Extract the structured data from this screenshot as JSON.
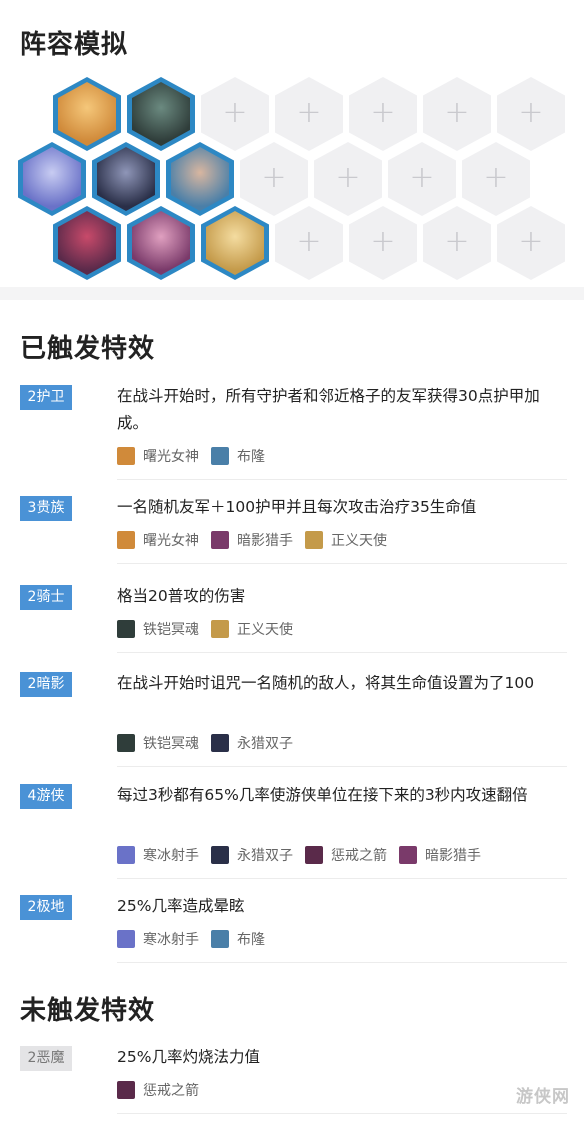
{
  "simulation": {
    "title": "阵容模拟",
    "slot_placeholder": "+",
    "champions": [
      {
        "name": "曙光女神",
        "icon": "leona-portrait-icon",
        "color": "#d08a3a",
        "accent": "#f5c77a"
      },
      {
        "name": "铁铠冥魂",
        "icon": "mordekaiser-portrait-icon",
        "color": "#2f3d3a",
        "accent": "#6b8a80"
      },
      {
        "name": "寒冰射手",
        "icon": "ashe-portrait-icon",
        "color": "#6a72c8",
        "accent": "#c8ccf2"
      },
      {
        "name": "永猎双子",
        "icon": "kindred-portrait-icon",
        "color": "#2a2f48",
        "accent": "#8f96b8"
      },
      {
        "name": "布隆",
        "icon": "braum-portrait-icon",
        "color": "#4a7fa8",
        "accent": "#d8b6a0"
      },
      {
        "name": "惩戒之箭",
        "icon": "varus-portrait-icon",
        "color": "#5a2a4a",
        "accent": "#c84a6a"
      },
      {
        "name": "暗影猎手",
        "icon": "vayne-portrait-icon",
        "color": "#7a3a6a",
        "accent": "#e0a0c0"
      },
      {
        "name": "正义天使",
        "icon": "kayle-portrait-icon",
        "color": "#c49a4a",
        "accent": "#f4dca0"
      }
    ]
  },
  "effects": {
    "active_title": "已触发特效",
    "inactive_title": "未触发特效",
    "active": [
      {
        "badge": "2护卫",
        "desc": "在战斗开始时，所有守护者和邻近格子的友军获得30点护甲加成。",
        "champions": [
          {
            "name": "曙光女神",
            "icon": "leona-icon",
            "color": "#d08a3a"
          },
          {
            "name": "布隆",
            "icon": "braum-icon",
            "color": "#4a7fa8"
          }
        ]
      },
      {
        "badge": "3贵族",
        "desc": "一名随机友军＋100护甲并且每次攻击治疗35生命值",
        "champions": [
          {
            "name": "曙光女神",
            "icon": "leona-icon",
            "color": "#d08a3a"
          },
          {
            "name": "暗影猎手",
            "icon": "vayne-icon",
            "color": "#7a3a6a"
          },
          {
            "name": "正义天使",
            "icon": "kayle-icon",
            "color": "#c49a4a"
          }
        ]
      },
      {
        "badge": "2骑士",
        "desc": "格当20普攻的伤害",
        "champions": [
          {
            "name": "铁铠冥魂",
            "icon": "mordekaiser-icon",
            "color": "#2f3d3a"
          },
          {
            "name": "正义天使",
            "icon": "kayle-icon",
            "color": "#c49a4a"
          }
        ]
      },
      {
        "badge": "2暗影",
        "desc": "在战斗开始时诅咒一名随机的敌人，将其生命值设置为了100",
        "champions": [
          {
            "name": "铁铠冥魂",
            "icon": "mordekaiser-icon",
            "color": "#2f3d3a"
          },
          {
            "name": "永猎双子",
            "icon": "kindred-icon",
            "color": "#2a2f48"
          }
        ]
      },
      {
        "badge": "4游侠",
        "desc": "每过3秒都有65%几率使游侠单位在接下来的3秒内攻速翻倍",
        "champions": [
          {
            "name": "寒冰射手",
            "icon": "ashe-icon",
            "color": "#6a72c8"
          },
          {
            "name": "永猎双子",
            "icon": "kindred-icon",
            "color": "#2a2f48"
          },
          {
            "name": "惩戒之箭",
            "icon": "varus-icon",
            "color": "#5a2a4a"
          },
          {
            "name": "暗影猎手",
            "icon": "vayne-icon",
            "color": "#7a3a6a"
          }
        ]
      },
      {
        "badge": "2极地",
        "desc": "25%几率造成晕眩",
        "champions": [
          {
            "name": "寒冰射手",
            "icon": "ashe-icon",
            "color": "#6a72c8"
          },
          {
            "name": "布隆",
            "icon": "braum-icon",
            "color": "#4a7fa8"
          }
        ]
      }
    ],
    "inactive": [
      {
        "badge": "2恶魔",
        "desc": "25%几率灼烧法力值",
        "champions": [
          {
            "name": "惩戒之箭",
            "icon": "varus-icon",
            "color": "#5a2a4a"
          }
        ]
      }
    ]
  },
  "watermark": "游侠网",
  "colors": {
    "hex_border": "#2d88c4",
    "badge_active": "#4a92d6",
    "badge_inactive": "#e4e4e6",
    "empty_slot": "#f0f0f2"
  }
}
